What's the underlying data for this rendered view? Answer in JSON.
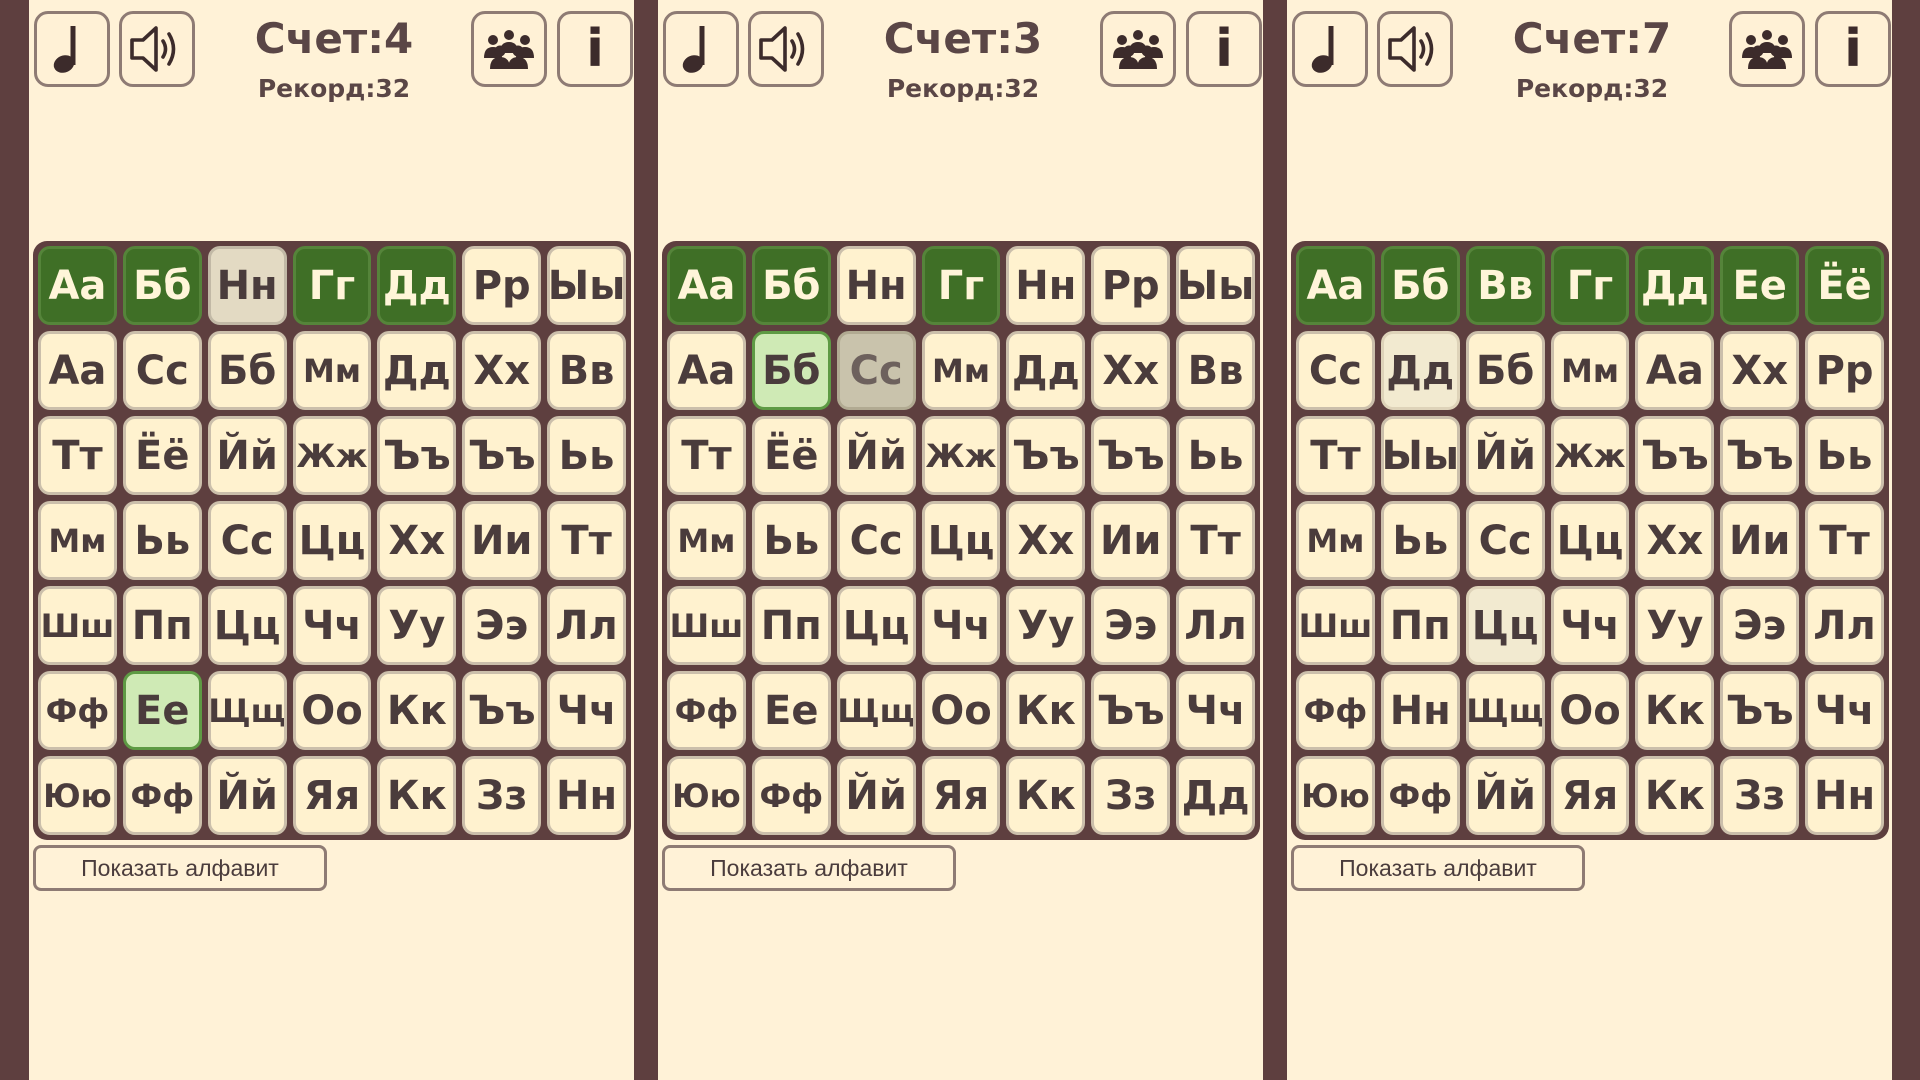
{
  "icons": {
    "music": "music-note-icon",
    "sound": "speaker-icon",
    "players": "group-icon",
    "info_glyph": "i"
  },
  "colors": {
    "frame": "#5e3f3f",
    "panel": "#fff2d7",
    "tile": "#fff2cf",
    "found": "#3f6f26",
    "picked": "#cfeab5",
    "text": "#4a3c3c"
  },
  "panels": [
    {
      "score": "Счет:4",
      "record": "Рекорд:32",
      "show_alphabet": "Показать алфавит",
      "grid": [
        [
          {
            "t": "Аа",
            "s": "found"
          },
          {
            "t": "Бб",
            "s": "found"
          },
          {
            "t": "Нн",
            "s": "pale"
          },
          {
            "t": "Гг",
            "s": "found"
          },
          {
            "t": "Дд",
            "s": "found"
          },
          {
            "t": "Рр",
            "s": ""
          },
          {
            "t": "Ыы",
            "s": ""
          }
        ],
        [
          {
            "t": "Аа",
            "s": ""
          },
          {
            "t": "Сс",
            "s": ""
          },
          {
            "t": "Бб",
            "s": ""
          },
          {
            "t": "Мм",
            "s": ""
          },
          {
            "t": "Дд",
            "s": ""
          },
          {
            "t": "Хх",
            "s": ""
          },
          {
            "t": "Вв",
            "s": ""
          }
        ],
        [
          {
            "t": "Тт",
            "s": ""
          },
          {
            "t": "Ёё",
            "s": ""
          },
          {
            "t": "Йй",
            "s": ""
          },
          {
            "t": "Жж",
            "s": ""
          },
          {
            "t": "Ъъ",
            "s": ""
          },
          {
            "t": "Ъъ",
            "s": ""
          },
          {
            "t": "Ьь",
            "s": ""
          }
        ],
        [
          {
            "t": "Мм",
            "s": ""
          },
          {
            "t": "Ьь",
            "s": ""
          },
          {
            "t": "Сс",
            "s": ""
          },
          {
            "t": "Цц",
            "s": ""
          },
          {
            "t": "Хх",
            "s": ""
          },
          {
            "t": "Ии",
            "s": ""
          },
          {
            "t": "Тт",
            "s": ""
          }
        ],
        [
          {
            "t": "Шш",
            "s": ""
          },
          {
            "t": "Пп",
            "s": ""
          },
          {
            "t": "Цц",
            "s": ""
          },
          {
            "t": "Чч",
            "s": ""
          },
          {
            "t": "Уу",
            "s": ""
          },
          {
            "t": "Ээ",
            "s": ""
          },
          {
            "t": "Лл",
            "s": ""
          }
        ],
        [
          {
            "t": "Фф",
            "s": ""
          },
          {
            "t": "Ее",
            "s": "picked"
          },
          {
            "t": "Щщ",
            "s": ""
          },
          {
            "t": "Оо",
            "s": ""
          },
          {
            "t": "Кк",
            "s": ""
          },
          {
            "t": "Ъъ",
            "s": ""
          },
          {
            "t": "Чч",
            "s": ""
          }
        ],
        [
          {
            "t": "Юю",
            "s": ""
          },
          {
            "t": "Фф",
            "s": ""
          },
          {
            "t": "Йй",
            "s": ""
          },
          {
            "t": "Яя",
            "s": ""
          },
          {
            "t": "Кк",
            "s": ""
          },
          {
            "t": "Зз",
            "s": ""
          },
          {
            "t": "Нн",
            "s": ""
          }
        ]
      ]
    },
    {
      "score": "Счет:3",
      "record": "Рекорд:32",
      "show_alphabet": "Показать алфавит",
      "grid": [
        [
          {
            "t": "Аа",
            "s": "found"
          },
          {
            "t": "Бб",
            "s": "found"
          },
          {
            "t": "Нн",
            "s": ""
          },
          {
            "t": "Гг",
            "s": "found"
          },
          {
            "t": "Нн",
            "s": ""
          },
          {
            "t": "Рр",
            "s": ""
          },
          {
            "t": "Ыы",
            "s": ""
          }
        ],
        [
          {
            "t": "Аа",
            "s": ""
          },
          {
            "t": "Бб",
            "s": "picked"
          },
          {
            "t": "Сс",
            "s": "dim"
          },
          {
            "t": "Мм",
            "s": ""
          },
          {
            "t": "Дд",
            "s": ""
          },
          {
            "t": "Хх",
            "s": ""
          },
          {
            "t": "Вв",
            "s": ""
          }
        ],
        [
          {
            "t": "Тт",
            "s": ""
          },
          {
            "t": "Ёё",
            "s": ""
          },
          {
            "t": "Йй",
            "s": ""
          },
          {
            "t": "Жж",
            "s": ""
          },
          {
            "t": "Ъъ",
            "s": ""
          },
          {
            "t": "Ъъ",
            "s": ""
          },
          {
            "t": "Ьь",
            "s": ""
          }
        ],
        [
          {
            "t": "Мм",
            "s": ""
          },
          {
            "t": "Ьь",
            "s": ""
          },
          {
            "t": "Сс",
            "s": ""
          },
          {
            "t": "Цц",
            "s": ""
          },
          {
            "t": "Хх",
            "s": ""
          },
          {
            "t": "Ии",
            "s": ""
          },
          {
            "t": "Тт",
            "s": ""
          }
        ],
        [
          {
            "t": "Шш",
            "s": ""
          },
          {
            "t": "Пп",
            "s": ""
          },
          {
            "t": "Цц",
            "s": ""
          },
          {
            "t": "Чч",
            "s": ""
          },
          {
            "t": "Уу",
            "s": ""
          },
          {
            "t": "Ээ",
            "s": ""
          },
          {
            "t": "Лл",
            "s": ""
          }
        ],
        [
          {
            "t": "Фф",
            "s": ""
          },
          {
            "t": "Ее",
            "s": ""
          },
          {
            "t": "Щщ",
            "s": ""
          },
          {
            "t": "Оо",
            "s": ""
          },
          {
            "t": "Кк",
            "s": ""
          },
          {
            "t": "Ъъ",
            "s": ""
          },
          {
            "t": "Чч",
            "s": ""
          }
        ],
        [
          {
            "t": "Юю",
            "s": ""
          },
          {
            "t": "Фф",
            "s": ""
          },
          {
            "t": "Йй",
            "s": ""
          },
          {
            "t": "Яя",
            "s": ""
          },
          {
            "t": "Кк",
            "s": ""
          },
          {
            "t": "Зз",
            "s": ""
          },
          {
            "t": "Дд",
            "s": ""
          }
        ]
      ]
    },
    {
      "score": "Счет:7",
      "record": "Рекорд:32",
      "show_alphabet": "Показать алфавит",
      "grid": [
        [
          {
            "t": "Аа",
            "s": "found"
          },
          {
            "t": "Бб",
            "s": "found"
          },
          {
            "t": "Вв",
            "s": "found"
          },
          {
            "t": "Гг",
            "s": "found"
          },
          {
            "t": "Дд",
            "s": "found"
          },
          {
            "t": "Ее",
            "s": "found"
          },
          {
            "t": "Ёё",
            "s": "found"
          }
        ],
        [
          {
            "t": "Сс",
            "s": ""
          },
          {
            "t": "Дд",
            "s": "hint"
          },
          {
            "t": "Бб",
            "s": ""
          },
          {
            "t": "Мм",
            "s": ""
          },
          {
            "t": "Аа",
            "s": ""
          },
          {
            "t": "Хх",
            "s": ""
          },
          {
            "t": "Рр",
            "s": ""
          }
        ],
        [
          {
            "t": "Тт",
            "s": ""
          },
          {
            "t": "Ыы",
            "s": ""
          },
          {
            "t": "Йй",
            "s": ""
          },
          {
            "t": "Жж",
            "s": ""
          },
          {
            "t": "Ъъ",
            "s": ""
          },
          {
            "t": "Ъъ",
            "s": ""
          },
          {
            "t": "Ьь",
            "s": ""
          }
        ],
        [
          {
            "t": "Мм",
            "s": ""
          },
          {
            "t": "Ьь",
            "s": ""
          },
          {
            "t": "Сс",
            "s": ""
          },
          {
            "t": "Цц",
            "s": ""
          },
          {
            "t": "Хх",
            "s": ""
          },
          {
            "t": "Ии",
            "s": ""
          },
          {
            "t": "Тт",
            "s": ""
          }
        ],
        [
          {
            "t": "Шш",
            "s": ""
          },
          {
            "t": "Пп",
            "s": ""
          },
          {
            "t": "Цц",
            "s": "hint"
          },
          {
            "t": "Чч",
            "s": ""
          },
          {
            "t": "Уу",
            "s": ""
          },
          {
            "t": "Ээ",
            "s": ""
          },
          {
            "t": "Лл",
            "s": ""
          }
        ],
        [
          {
            "t": "Фф",
            "s": ""
          },
          {
            "t": "Нн",
            "s": ""
          },
          {
            "t": "Щщ",
            "s": ""
          },
          {
            "t": "Оо",
            "s": ""
          },
          {
            "t": "Кк",
            "s": ""
          },
          {
            "t": "Ъъ",
            "s": ""
          },
          {
            "t": "Чч",
            "s": ""
          }
        ],
        [
          {
            "t": "Юю",
            "s": ""
          },
          {
            "t": "Фф",
            "s": ""
          },
          {
            "t": "Йй",
            "s": ""
          },
          {
            "t": "Яя",
            "s": ""
          },
          {
            "t": "Кк",
            "s": ""
          },
          {
            "t": "Зз",
            "s": ""
          },
          {
            "t": "Нн",
            "s": ""
          }
        ]
      ]
    }
  ]
}
